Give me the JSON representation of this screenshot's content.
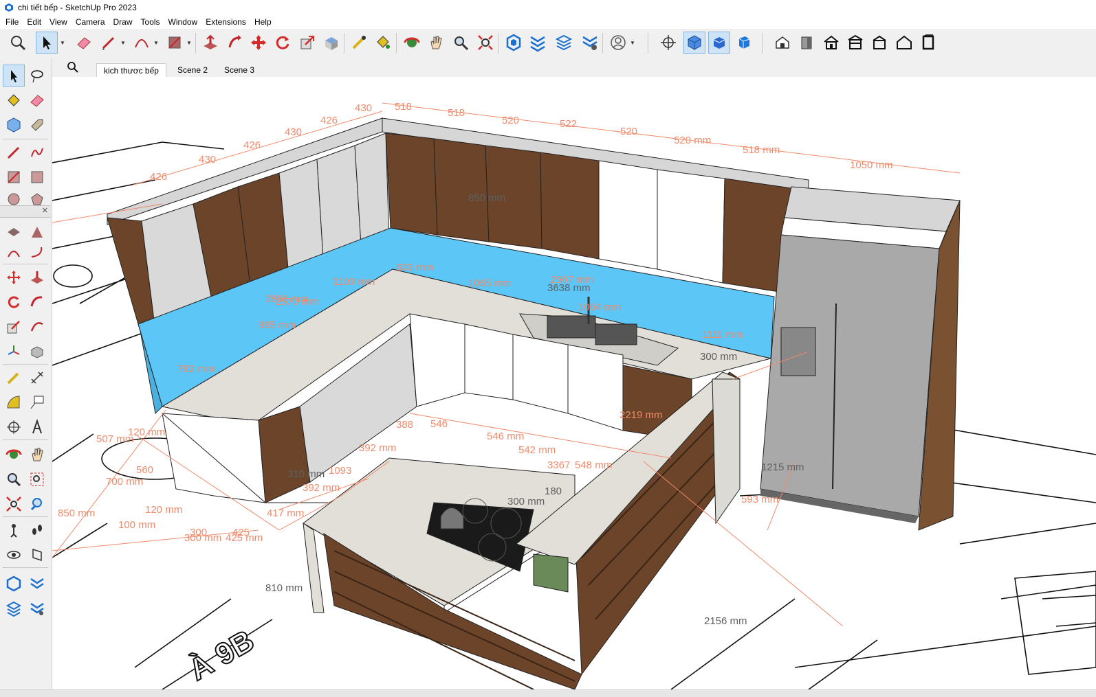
{
  "window": {
    "title": "chi tiết bếp - SketchUp Pro 2023"
  },
  "menu": [
    "File",
    "Edit",
    "View",
    "Camera",
    "Draw",
    "Tools",
    "Window",
    "Extensions",
    "Help"
  ],
  "toolbar": {
    "icons": [
      "zoom-icon",
      "select-icon",
      "eraser-icon",
      "pencil-icon",
      "arc-icon",
      "rectangle-icon",
      "push-pull-icon",
      "follow-me-icon",
      "move-icon",
      "rotate-icon",
      "scale-icon",
      "offset-icon",
      "tape-measure-icon",
      "paint-bucket-icon",
      "orbit-icon",
      "pan-icon",
      "zoom-tool-icon",
      "zoom-extents-icon",
      "components-icon",
      "styles-icon",
      "layers-icon",
      "extensions-icon",
      "user-icon",
      "position-camera-icon",
      "iso-view-icon",
      "top-view-icon",
      "front-view-icon",
      "right-view-icon",
      "back-view-icon",
      "left-view-icon",
      "home-view-icon",
      "section-icon",
      "outliner-icon"
    ]
  },
  "scenes": {
    "tabs": [
      "kich thươc bếp",
      "Scene 2",
      "Scene 3"
    ],
    "active": 0
  },
  "viewport": {
    "top_dims": [
      "426",
      "430",
      "426",
      "430",
      "426",
      "430",
      "518",
      "518",
      "520",
      "522",
      "520",
      "520 mm",
      "518 mm",
      "1050 mm"
    ],
    "dims": [
      "850 mm",
      "1109 mm",
      "2886 mm",
      "2570 mm",
      "603 mm",
      "1065 mm",
      "3638 mm",
      "2967 mm",
      "1064 mm",
      "995 mm",
      "782 mm",
      "1111 mm",
      "300 mm",
      "2219 mm",
      "388",
      "546",
      "546 mm",
      "542 mm",
      "392 mm",
      "3367",
      "548 mm",
      "310 mm",
      "1093",
      "392 mm",
      "180",
      "300 mm",
      "1215 mm",
      "593 mm",
      "507 mm",
      "120 mm",
      "560",
      "700 mm",
      "120 mm",
      "100 mm",
      "850 mm",
      "300",
      "425",
      "300 mm",
      "425 mm",
      "417 mm",
      "810 mm",
      "2156 mm"
    ],
    "floor_text": "À 9B"
  },
  "colors": {
    "dimension": "#f08a6a",
    "glass": "#5cc6f7",
    "wood": "#6b4429",
    "counter": "#e2dfd9",
    "fridge": "#a9a9a9"
  }
}
